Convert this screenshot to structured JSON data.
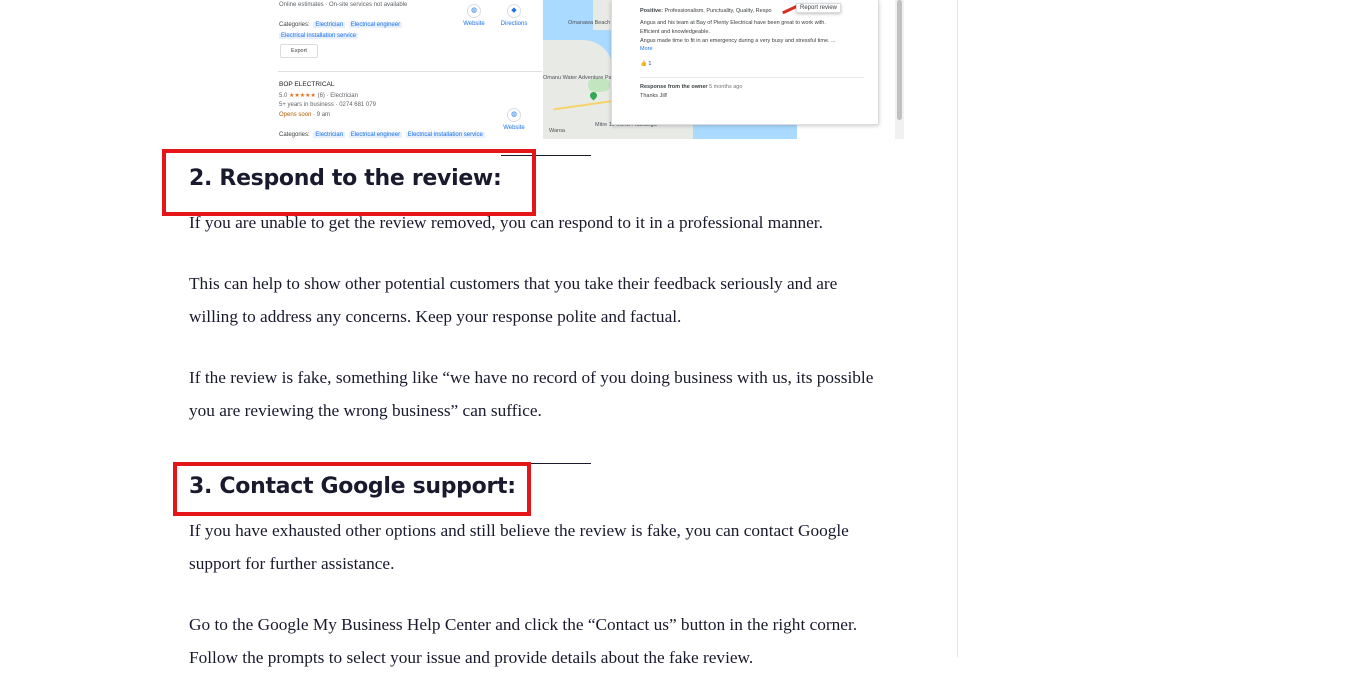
{
  "screenshot": {
    "list": {
      "first_business": {
        "services": "Online estimates · On-site services not available",
        "categories_label": "Categories:",
        "categories": [
          "Electrician",
          "Electrical engineer"
        ],
        "categories_extra": "Electrical installation service",
        "export_label": "Export",
        "website_label": "Website",
        "directions_label": "Directions"
      },
      "second_business": {
        "name": "BOP ELECTRICAL",
        "rating": "5.0",
        "stars": "★★★★★",
        "review_count": "(6)",
        "category": "· Electrician",
        "years": "5+ years in business",
        "phone": "· 0274 681 079",
        "opens": "Opens soon",
        "opens_time": "· 9 am",
        "categories_label": "Categories:",
        "categories": [
          "Electrician",
          "Electrical engineer",
          "Electrical installation service"
        ],
        "website_label": "Website"
      }
    },
    "map_labels": [
      "Omanawa Beach",
      "Omanu Water Adventure Park",
      "Mitre 10 MEGA Tauranga",
      "Waroa"
    ],
    "review": {
      "report_label": "Report review",
      "positive_label": "Positive:",
      "positive_text": "Professionalism, Punctuality, Quality, Respo",
      "body_line1": "Angus and his team at Bay of Plenty Electrical have been great to work with.",
      "body_line2": "Efficient and knowledgeable.",
      "body_line3": "Angus made time to fit in an emergency during a very busy and stressful time. ...",
      "more_label": "More",
      "likes": "1",
      "owner_label": "Response from the owner",
      "owner_time": "5 months ago",
      "owner_reply": "Thanks Jill!"
    }
  },
  "section2": {
    "heading": "2. Respond to the review:",
    "paragraphs": [
      "If you are unable to get the review removed, you can respond to it in a professional manner.",
      "This can help to show other potential customers that you take their feedback seriously and are willing to address any concerns. Keep your response polite and factual.",
      "If the review is fake, something like “we have no record of you doing business with us, its possible you are reviewing the wrong business” can suffice."
    ]
  },
  "section3": {
    "heading": "3. Contact Google support:",
    "paragraphs": [
      "If you have exhausted other options and still believe the review is fake, you can contact Google support for further assistance.",
      "Go to the Google My Business Help Center and click the “Contact us” button in the right corner. Follow the prompts to select your issue and provide details about the fake review."
    ]
  },
  "colors": {
    "highlight_box": "#e5161a",
    "text": "#1a1a2e",
    "link_blue": "#1a73e8"
  },
  "icons": [
    "website-globe-icon",
    "directions-icon",
    "thumbs-up-icon",
    "map-pin-icon"
  ]
}
